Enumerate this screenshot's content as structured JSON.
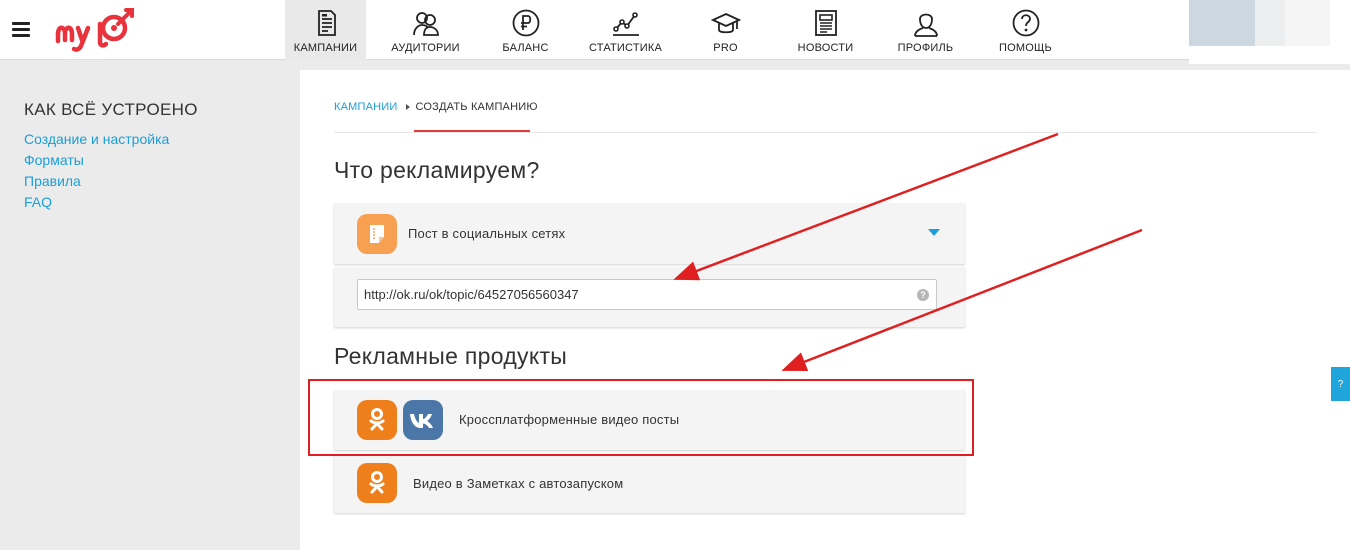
{
  "header": {
    "nav": [
      {
        "label": "КАМПАНИИ",
        "icon": "campaigns-icon",
        "active": true
      },
      {
        "label": "АУДИТОРИИ",
        "icon": "audiences-icon"
      },
      {
        "label": "БАЛАНС",
        "icon": "ruble-icon"
      },
      {
        "label": "СТАТИСТИКА",
        "icon": "chart-icon"
      },
      {
        "label": "PRO",
        "icon": "graduation-cap-icon"
      },
      {
        "label": "НОВОСТИ",
        "icon": "newspaper-icon"
      },
      {
        "label": "ПРОФИЛЬ",
        "icon": "user-icon"
      },
      {
        "label": "ПОМОЩЬ",
        "icon": "help-icon"
      }
    ]
  },
  "sidebar": {
    "title": "КАК ВСЁ УСТРОЕНО",
    "links": [
      "Создание и настройка",
      "Форматы",
      "Правила",
      "FAQ"
    ]
  },
  "breadcrumb": {
    "parent": "КАМПАНИИ",
    "current": "СОЗДАТЬ КАМПАНИЮ"
  },
  "advertise": {
    "title": "Что рекламируем?",
    "selected_type": "Пост в социальных сетях",
    "url_value": "http://ok.ru/ok/topic/64527056560347",
    "help_glyph": "?"
  },
  "products": {
    "title": "Рекламные продукты",
    "items": [
      {
        "label": "Кроссплатформенные видео посты"
      },
      {
        "label": "Видео в Заметках с автозапуском"
      }
    ]
  },
  "side_tab": {
    "label": "?"
  },
  "colors": {
    "accent": "#1a9fd8",
    "brand_red": "#e03b3b",
    "ok_orange": "#ee7f1b",
    "vk_blue": "#4a76a8",
    "annotation_red": "#e02020"
  }
}
